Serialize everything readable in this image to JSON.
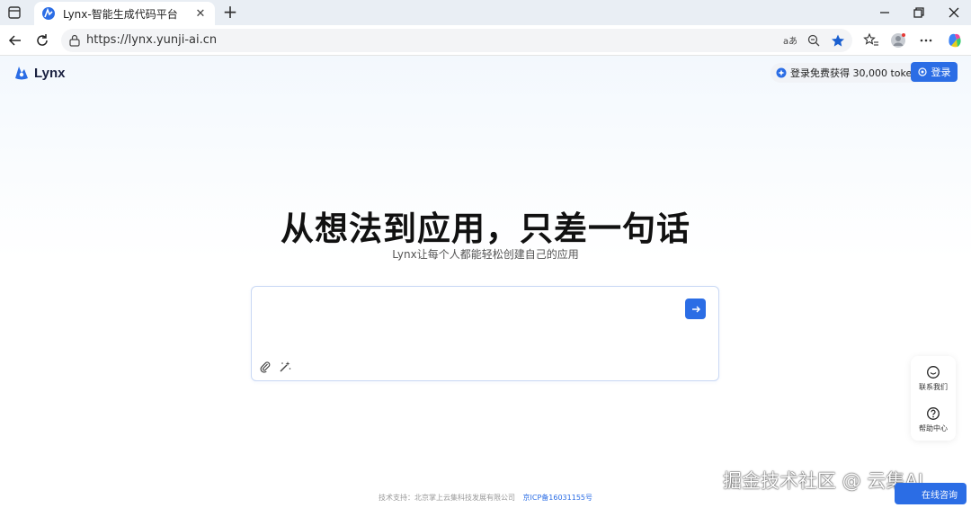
{
  "browser": {
    "tab_title": "Lynx-智能生成代码平台",
    "url": "https://lynx.yunji-ai.cn"
  },
  "page": {
    "logo_text": "Lynx",
    "promo_text": "登录免费获得 30,000 token",
    "login_label": "登录",
    "headline": "从想法到应用，只差一句话",
    "subline": "Lynx让每个人都能轻松创建自己的应用",
    "composer": {
      "value": "",
      "placeholder": ""
    },
    "float_panel": {
      "contact_label": "联系我们",
      "help_label": "帮助中心"
    },
    "footer": {
      "support_text": "技术支持：北京掌上云集科技发展有限公司",
      "icp_text": "京ICP备16031155号"
    },
    "chat_label": "在线咨询",
    "watermark": "掘金技术社区 @ 云集AI"
  },
  "colors": {
    "accent": "#2b6de5"
  }
}
